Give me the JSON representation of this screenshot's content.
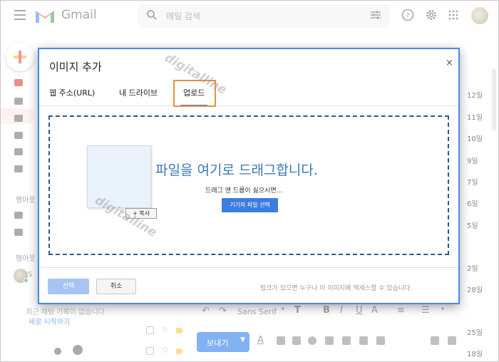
{
  "gmail": {
    "brand": "Gmail",
    "search_placeholder": "메일 검색",
    "side_section_1": "행아웃",
    "side_section_2": "행아웃",
    "side_user_initials": "JS",
    "side_bottom_line1": "최근 채팅 기록이 없습니다.",
    "side_bottom_link": "새로 시작하기",
    "dates": [
      "12일",
      "11일",
      "10일",
      "9일",
      "7일",
      "6일",
      "5일",
      "2일",
      "28일",
      "25일",
      "18일"
    ]
  },
  "compose": {
    "font_name": "Sans Serif",
    "send_label": "보내기"
  },
  "dialog": {
    "title": "이미지 추가",
    "close_glyph": "×",
    "tabs": [
      {
        "label": "웹 주소(URL)"
      },
      {
        "label": "내 드라이브"
      },
      {
        "label": "업로드"
      }
    ],
    "active_tab": 2,
    "drag_main": "파일을 여기로 드래그합니다.",
    "drag_sub": "드래그 앤 드롭이 싫으시면...",
    "choose_button": "기기의 파일 선택",
    "copy_chip": "+ 복사",
    "select_button": "선택",
    "cancel_button": "취소",
    "footer_note": "링크가 있으면 누구나 이 이미지에 액세스할 수 있습니다."
  },
  "watermark": "digitalline",
  "colors": {
    "dialog_border": "#4a86e8",
    "tab_highlight": "#e8913a",
    "primary_button": "#3b7de0",
    "drag_text": "#3b78b6"
  }
}
